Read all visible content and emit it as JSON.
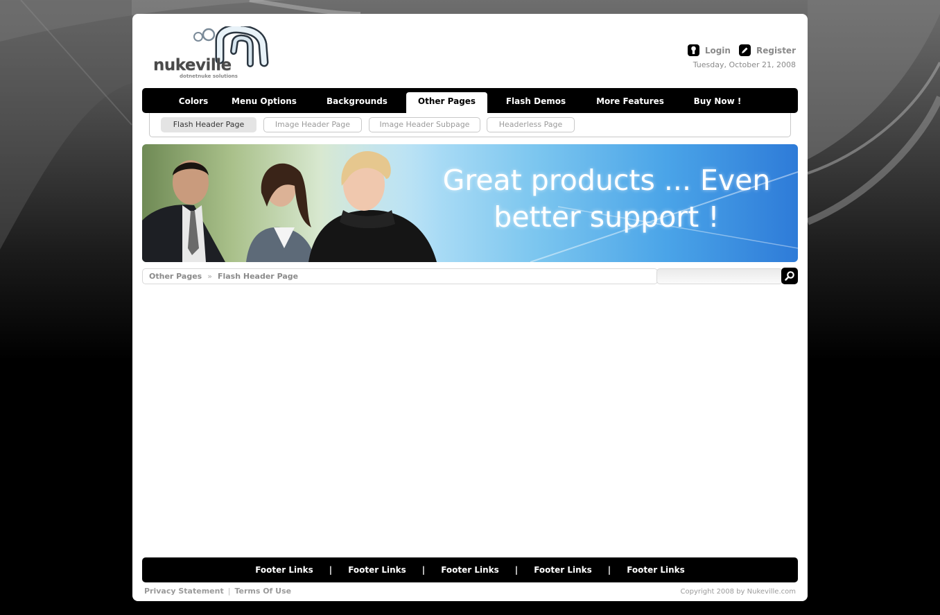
{
  "brand": {
    "name": "nukeville",
    "tagline": "dotnetnuke solutions"
  },
  "header": {
    "login_label": "Login",
    "register_label": "Register",
    "date": "Tuesday, October 21, 2008"
  },
  "main_menu": {
    "items": [
      {
        "label": "Colors",
        "active": false
      },
      {
        "label": "Menu Options",
        "active": false
      },
      {
        "label": "Backgrounds",
        "active": false
      },
      {
        "label": "Other Pages",
        "active": true
      },
      {
        "label": "Flash Demos",
        "active": false
      },
      {
        "label": "More Features",
        "active": false
      },
      {
        "label": "Buy Now !",
        "active": false
      }
    ]
  },
  "sub_menu": {
    "items": [
      {
        "label": "Flash Header Page",
        "active": true
      },
      {
        "label": "Image Header Page",
        "active": false
      },
      {
        "label": "Image Header Subpage",
        "active": false
      },
      {
        "label": "Headerless Page",
        "active": false
      }
    ]
  },
  "banner": {
    "line1": "Great products ... Even",
    "line2": "better support !"
  },
  "breadcrumb": {
    "parent": "Other Pages",
    "separator": "»",
    "current": "Flash Header Page"
  },
  "search": {
    "value": "",
    "icon": "search-icon"
  },
  "footer": {
    "links": [
      "Footer Links",
      "Footer Links",
      "Footer Links",
      "Footer Links",
      "Footer Links"
    ],
    "separator": "|",
    "privacy_label": "Privacy Statement",
    "terms_label": "Terms Of Use",
    "copyright": "Copyright 2008 by Nukeville.com"
  },
  "colors": {
    "accent": "#000000",
    "muted_text": "#8a8a8a",
    "banner_blue": "#4aa4e8"
  }
}
